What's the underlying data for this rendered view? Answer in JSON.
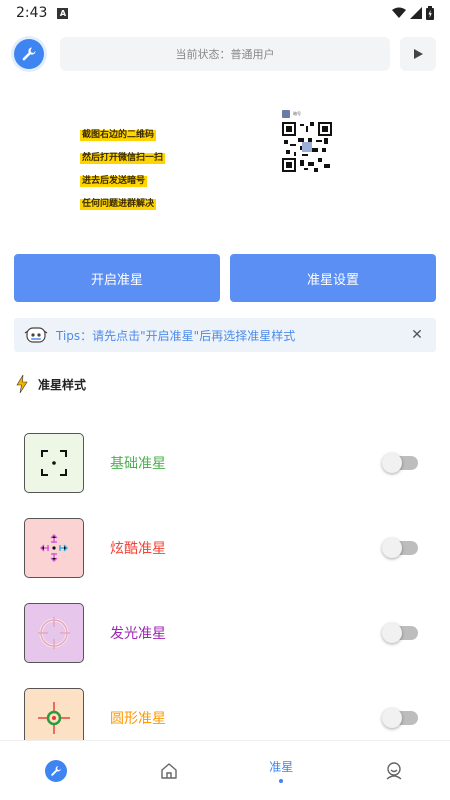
{
  "status_bar": {
    "time": "2:43",
    "notification_letter": "A"
  },
  "header": {
    "status_text": "当前状态：普通用户"
  },
  "banner": {
    "lines": [
      "截图右边的二维码",
      "然后打开微信扫一扫",
      "进去后发送暗号",
      "任何问题进群解决"
    ],
    "qr_name": "暗号"
  },
  "buttons": {
    "start": "开启准星",
    "settings": "准星设置"
  },
  "tips": {
    "text": "Tips：请先点击\"开启准星\"后再选择准星样式"
  },
  "section": {
    "title": "准星样式"
  },
  "styles": [
    {
      "name": "基础准星",
      "color": "#4caf50",
      "bg": "#eef6e6",
      "enabled": false
    },
    {
      "name": "炫酷准星",
      "color": "#f44336",
      "bg": "#fbd3d3",
      "enabled": false
    },
    {
      "name": "发光准星",
      "color": "#9c27b0",
      "bg": "#e6c6ea",
      "enabled": false
    },
    {
      "name": "圆形准星",
      "color": "#ff9800",
      "bg": "#fce1c4",
      "enabled": false
    }
  ],
  "bottom_nav": {
    "active_label": "准星"
  },
  "colors": {
    "accent": "#3f85f1",
    "button": "#5b8ff4",
    "tips_text": "#4d8be9"
  }
}
